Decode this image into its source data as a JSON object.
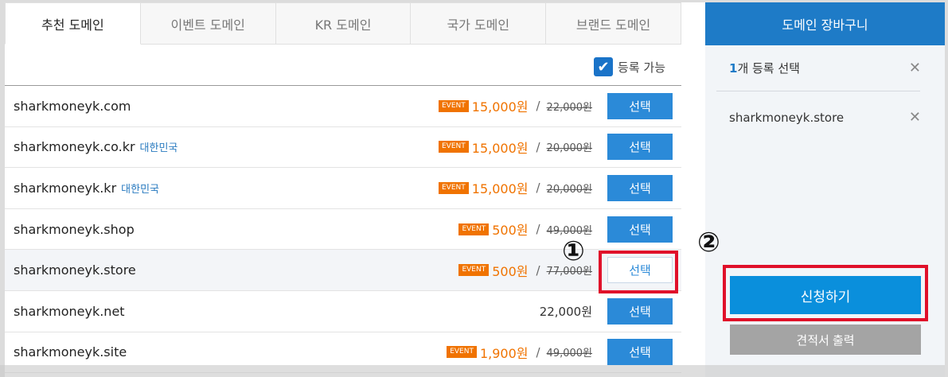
{
  "tabs": [
    {
      "label": "추천 도메인"
    },
    {
      "label": "이벤트 도메인"
    },
    {
      "label": "KR 도메인"
    },
    {
      "label": "국가 도메인"
    },
    {
      "label": "브랜드 도메인"
    }
  ],
  "filter": {
    "label": "등록 가능",
    "checked": true
  },
  "rows": [
    {
      "domain": "sharkmoneyk.com",
      "country": "",
      "event": "EVENT",
      "sale": "15,000원",
      "orig": "22,000원",
      "price": "",
      "button": "선택"
    },
    {
      "domain": "sharkmoneyk.co.kr",
      "country": "대한민국",
      "event": "EVENT",
      "sale": "15,000원",
      "orig": "20,000원",
      "price": "",
      "button": "선택"
    },
    {
      "domain": "sharkmoneyk.kr",
      "country": "대한민국",
      "event": "EVENT",
      "sale": "15,000원",
      "orig": "20,000원",
      "price": "",
      "button": "선택"
    },
    {
      "domain": "sharkmoneyk.shop",
      "country": "",
      "event": "EVENT",
      "sale": "500원",
      "orig": "49,000원",
      "price": "",
      "button": "선택"
    },
    {
      "domain": "sharkmoneyk.store",
      "country": "",
      "event": "EVENT",
      "sale": "500원",
      "orig": "77,000원",
      "price": "",
      "button": "선택"
    },
    {
      "domain": "sharkmoneyk.net",
      "country": "",
      "event": "",
      "sale": "",
      "orig": "",
      "price": "22,000원",
      "button": "선택"
    },
    {
      "domain": "sharkmoneyk.site",
      "country": "",
      "event": "EVENT",
      "sale": "1,900원",
      "orig": "49,000원",
      "price": "",
      "button": "선택"
    }
  ],
  "cart": {
    "title": "도메인 장바구니",
    "count_num": "1",
    "count_text": "개 등록 선택",
    "item": "sharkmoneyk.store",
    "apply_label": "신청하기",
    "quote_label": "견적서 출력"
  },
  "annotations": {
    "marker1": "①",
    "marker2": "②"
  },
  "colors": {
    "accent": "#1e7bc7",
    "event": "#f07300",
    "highlight": "#e0102a",
    "apply": "#0a8fdc"
  }
}
